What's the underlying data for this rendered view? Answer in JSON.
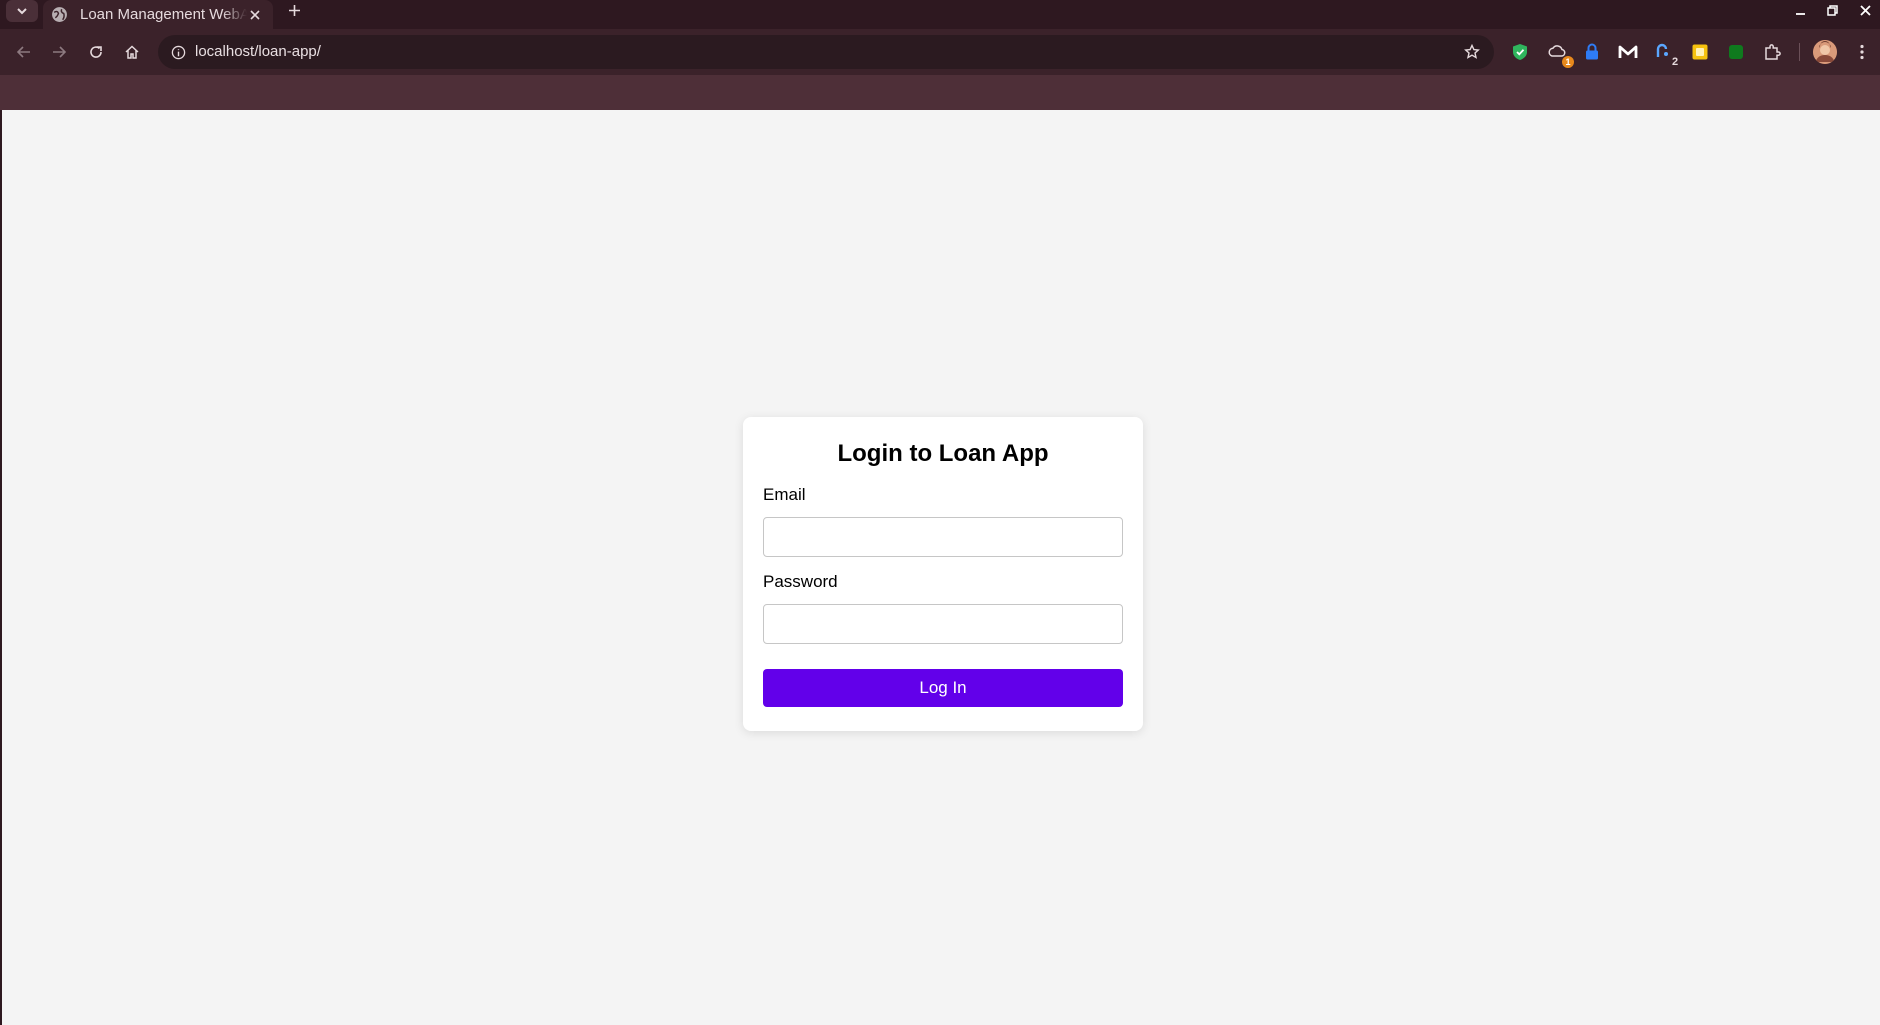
{
  "browser": {
    "tab_title": "Loan Management WebApp",
    "url": "localhost/loan-app/",
    "extensions": [
      {
        "name": "shield-extension-icon",
        "badge": ""
      },
      {
        "name": "weather-extension-icon",
        "badge": "1"
      },
      {
        "name": "lock-extension-icon",
        "badge": ""
      },
      {
        "name": "m-extension-icon",
        "badge": ""
      },
      {
        "name": "number-extension-icon",
        "badge": "2"
      },
      {
        "name": "note-extension-icon",
        "badge": ""
      },
      {
        "name": "green-square-extension-icon",
        "badge": ""
      },
      {
        "name": "puzzle-extensions-icon",
        "badge": ""
      }
    ]
  },
  "colors": {
    "chrome_bg": "#4e2f38",
    "page_bg": "#f4f4f4",
    "primary_button": "#6200ea"
  },
  "login": {
    "title": "Login to Loan App",
    "email_label": "Email",
    "email_value": "",
    "password_label": "Password",
    "password_value": "",
    "submit_label": "Log In"
  }
}
